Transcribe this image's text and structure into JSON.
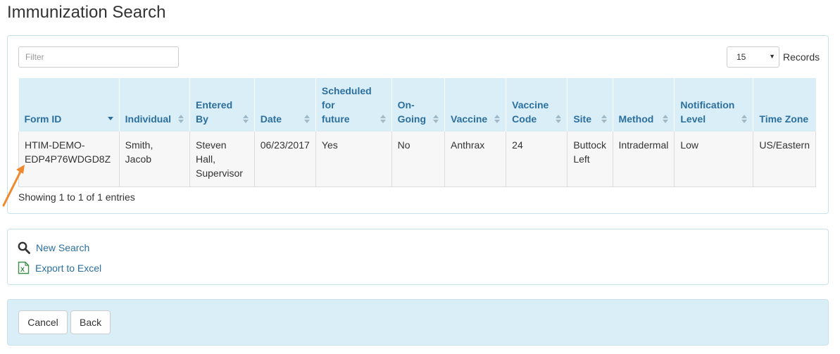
{
  "page": {
    "title": "Immunization Search"
  },
  "filter": {
    "placeholder": "Filter",
    "value": ""
  },
  "records": {
    "selected": "15",
    "label": "Records"
  },
  "table": {
    "headers": [
      "Form ID",
      "Individual",
      "Entered By",
      "Date",
      "Scheduled for future",
      "On-Going",
      "Vaccine",
      "Vaccine Code",
      "Site",
      "Method",
      "Notification Level",
      "Time Zone"
    ],
    "header_lines": [
      [
        "Form ID"
      ],
      [
        "Individual"
      ],
      [
        "Entered By"
      ],
      [
        "Date"
      ],
      [
        "Scheduled for",
        "future"
      ],
      [
        "On-",
        "Going"
      ],
      [
        "Vaccine"
      ],
      [
        "Vaccine",
        "Code"
      ],
      [
        "Site"
      ],
      [
        "Method"
      ],
      [
        "Notification",
        "Level"
      ],
      [
        "Time Zone"
      ]
    ],
    "rows": [
      {
        "form_id": [
          "HTIM-DEMO-",
          "EDP4P76WDGD8Z"
        ],
        "individual": [
          "Smith,",
          "Jacob"
        ],
        "entered_by": [
          "Steven Hall,",
          "Supervisor"
        ],
        "date": "06/23/2017",
        "scheduled": "Yes",
        "ongoing": "No",
        "vaccine": "Anthrax",
        "vaccine_code": "24",
        "site": [
          "Buttock",
          "Left"
        ],
        "method": "Intradermal",
        "notification": "Low",
        "timezone": "US/Eastern"
      }
    ]
  },
  "showing": "Showing 1 to 1 of 1 entries",
  "actions": {
    "new_search": "New Search",
    "export_excel": "Export to Excel"
  },
  "buttons": {
    "cancel": "Cancel",
    "back": "Back"
  },
  "colors": {
    "accent": "#2b6f9e",
    "header_bg": "#daeef8",
    "arrow": "#f0882c",
    "excel_green": "#3f8f4a"
  }
}
